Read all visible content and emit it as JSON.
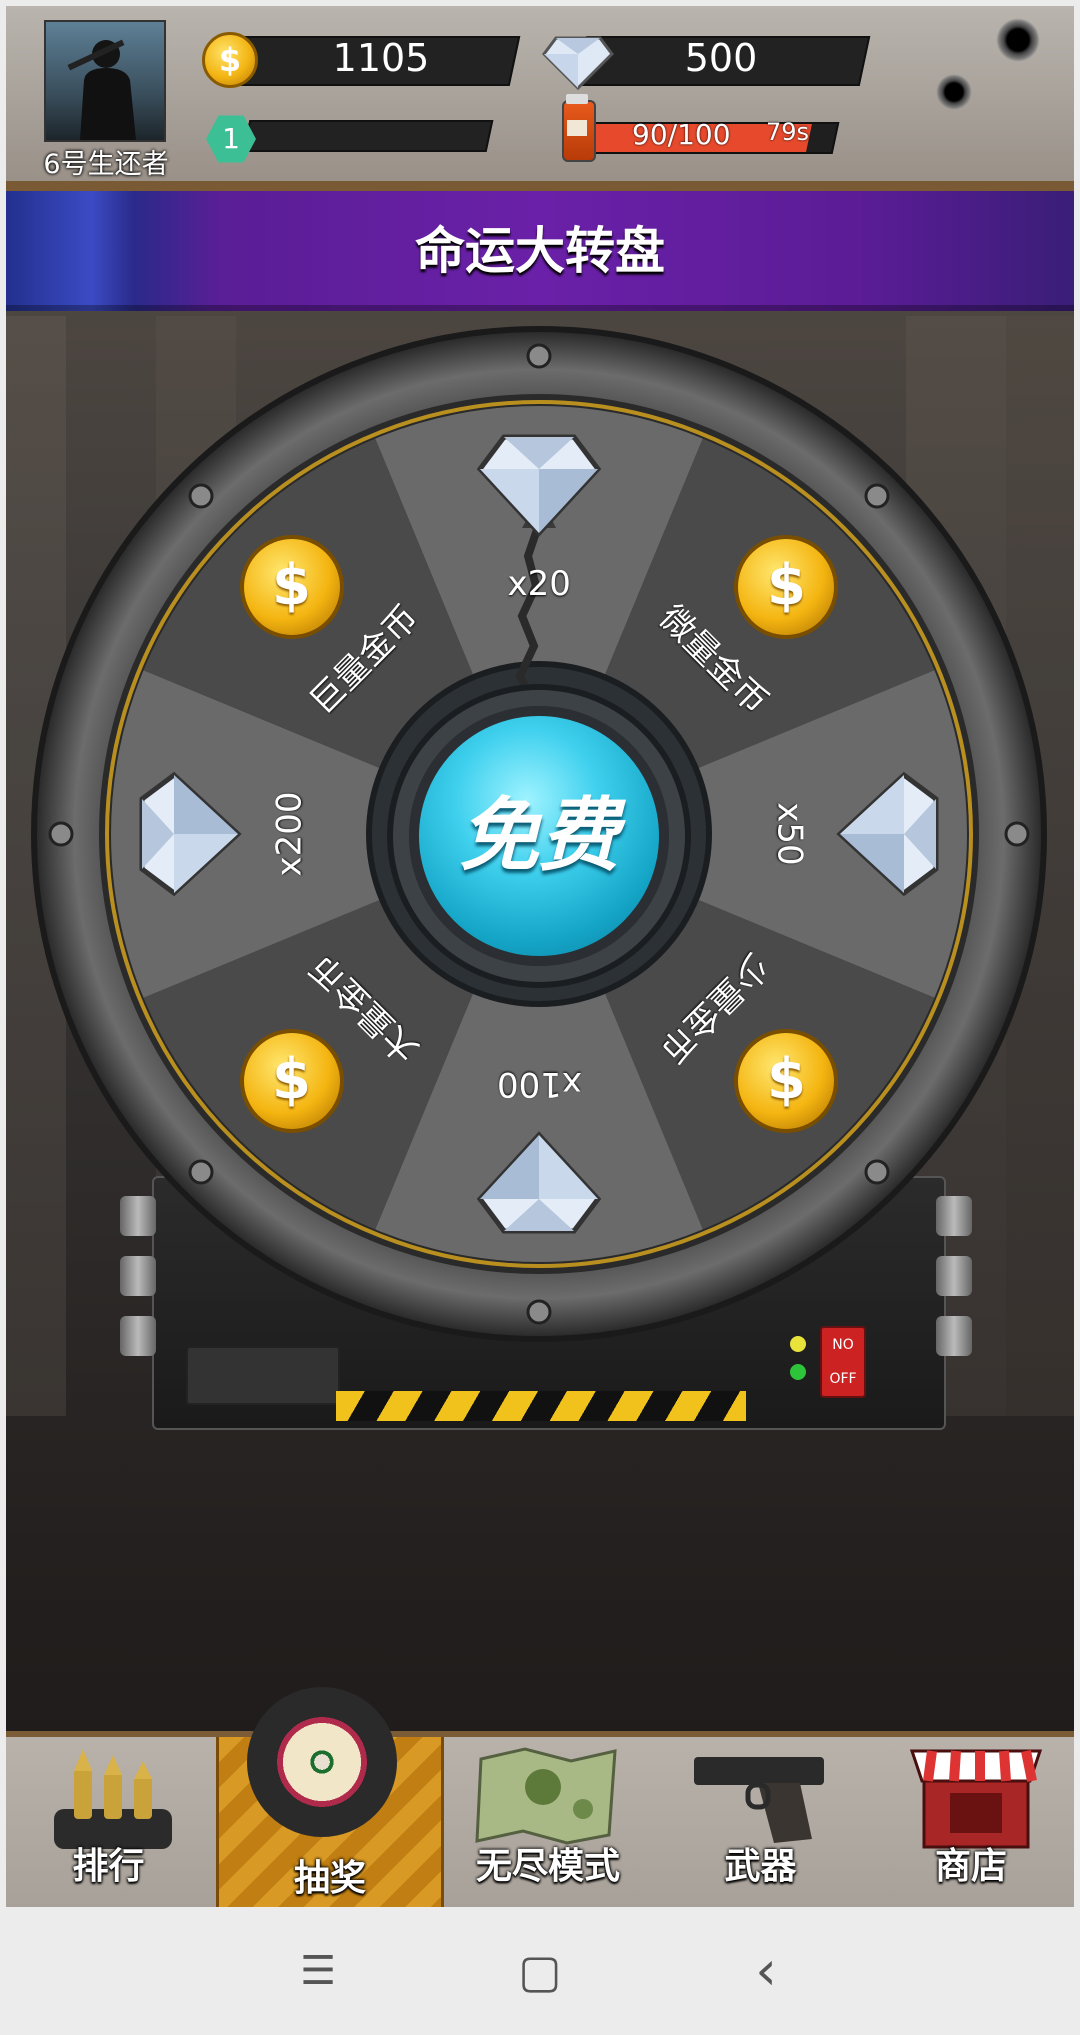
{
  "player": {
    "name": "6号生还者",
    "level": "1"
  },
  "resources": {
    "coins": "1105",
    "diamonds": "500",
    "energy": "90/100",
    "energy_fraction": 0.9,
    "timer": "79s",
    "coin_symbol": "$"
  },
  "banner": {
    "title": "命运大转盘"
  },
  "wheel": {
    "segments": [
      {
        "label": "x20",
        "icon": "diamond-icon"
      },
      {
        "label": "微量金币",
        "icon": "coin-icon"
      },
      {
        "label": "x50",
        "icon": "diamond-icon"
      },
      {
        "label": "少量金币",
        "icon": "coin-icon"
      },
      {
        "label": "x100",
        "icon": "diamond-icon"
      },
      {
        "label": "大量金币",
        "icon": "coin-icon"
      },
      {
        "label": "x200",
        "icon": "diamond-icon"
      },
      {
        "label": "巨量金币",
        "icon": "coin-icon"
      }
    ],
    "spin_button": "免费",
    "switch_on": "NO",
    "switch_off": "OFF"
  },
  "nav": [
    {
      "label": "排行",
      "icon": "bullets-icon"
    },
    {
      "label": "抽奖",
      "icon": "dartboard-icon",
      "active": true
    },
    {
      "label": "无尽模式",
      "icon": "map-icon"
    },
    {
      "label": "武器",
      "icon": "pistol-icon"
    },
    {
      "label": "商店",
      "icon": "shop-icon"
    }
  ],
  "system_nav": {
    "menu": "☰",
    "home": "▢",
    "back": "‹"
  }
}
